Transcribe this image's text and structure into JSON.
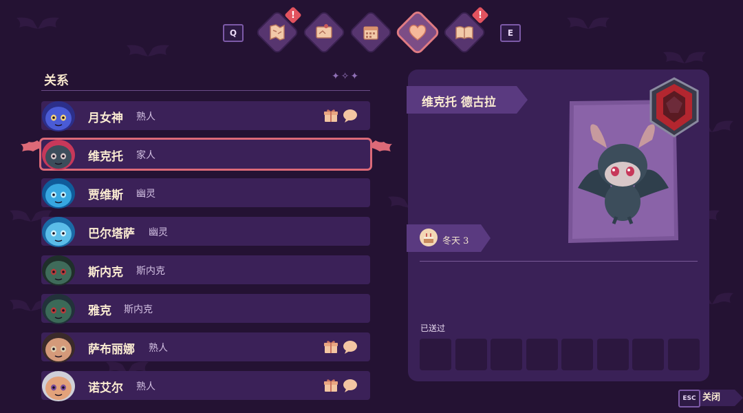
{
  "top_tabs": {
    "prev_key": "Q",
    "next_key": "E",
    "tabs": [
      {
        "icon": "map-scroll-icon",
        "alert": "!"
      },
      {
        "icon": "quest-map-icon",
        "alert": ""
      },
      {
        "icon": "calendar-icon",
        "alert": ""
      },
      {
        "icon": "heart-icon",
        "alert": "",
        "active": true
      },
      {
        "icon": "book-icon",
        "alert": "!"
      }
    ]
  },
  "relations": {
    "title": "关系",
    "rows": [
      {
        "name": "月女神",
        "relation": "熟人",
        "has_gift": true,
        "has_chat": true,
        "avatar": "moon-goddess-avatar"
      },
      {
        "name": "维克托",
        "relation": "家人",
        "has_gift": false,
        "has_chat": false,
        "avatar": "victor-bat-avatar",
        "selected": true
      },
      {
        "name": "贾维斯",
        "relation": "幽灵",
        "has_gift": false,
        "has_chat": false,
        "avatar": "jarvis-ghost-avatar"
      },
      {
        "name": "巴尔塔萨",
        "relation": "幽灵",
        "has_gift": false,
        "has_chat": false,
        "avatar": "balthazar-ghost-avatar"
      },
      {
        "name": "斯内克",
        "relation": "斯内克",
        "has_gift": false,
        "has_chat": false,
        "avatar": "snake-avatar"
      },
      {
        "name": "雅克",
        "relation": "斯内克",
        "has_gift": false,
        "has_chat": false,
        "avatar": "jacques-avatar"
      },
      {
        "name": "萨布丽娜",
        "relation": "熟人",
        "has_gift": true,
        "has_chat": true,
        "avatar": "sabrina-avatar"
      },
      {
        "name": "诺艾尔",
        "relation": "熟人",
        "has_gift": true,
        "has_chat": true,
        "avatar": "noel-avatar"
      }
    ]
  },
  "detail": {
    "full_name": "维克托 德古拉",
    "birthday": "冬天 3",
    "gifted_label": "已送过",
    "gift_slots": 8
  },
  "footer": {
    "esc_key": "ESC",
    "close_label": "关闭"
  },
  "colors": {
    "background": "#241233",
    "row": "#3b2158",
    "highlight": "#dd6a78",
    "text": "#fbecd2"
  }
}
